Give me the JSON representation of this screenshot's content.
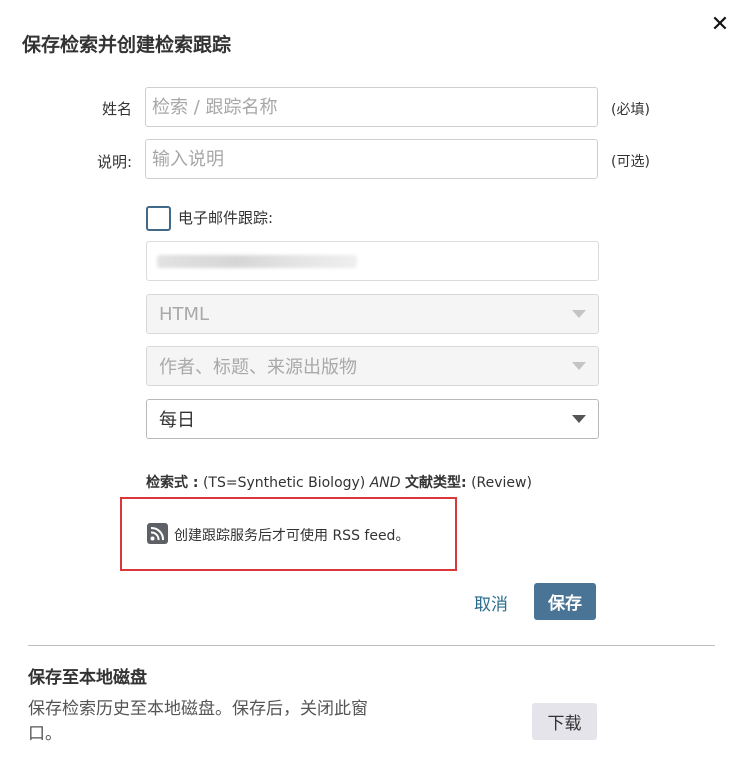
{
  "dialog": {
    "title": "保存检索并创建检索跟踪",
    "close_glyph": "✕"
  },
  "form": {
    "name_label": "姓名",
    "name_placeholder": "检索 / 跟踪名称",
    "name_note": "(必填)",
    "desc_label": "说明:",
    "desc_placeholder": "输入说明",
    "desc_note": "(可选)",
    "email_alert_label": "电子邮件跟踪:",
    "email_alert_checked": false,
    "format_select": "HTML",
    "content_select": "作者、标题、来源出版物",
    "frequency_select": "每日"
  },
  "query": {
    "label": "检索式 :",
    "part1": "(TS=Synthetic Biology)",
    "operator": "AND",
    "doc_type_label": "文献类型:",
    "doc_type_value": "(Review)"
  },
  "rss": {
    "icon": "rss-icon",
    "text": "创建跟踪服务后才可使用 RSS feed。"
  },
  "actions": {
    "cancel": "取消",
    "save": "保存"
  },
  "local": {
    "title": "保存至本地磁盘",
    "description": "保存检索历史至本地磁盘。保存后，关闭此窗口。",
    "download": "下载"
  },
  "colors": {
    "primary": "#4a7496",
    "link": "#2b6c8e",
    "highlight": "#d9383b"
  }
}
